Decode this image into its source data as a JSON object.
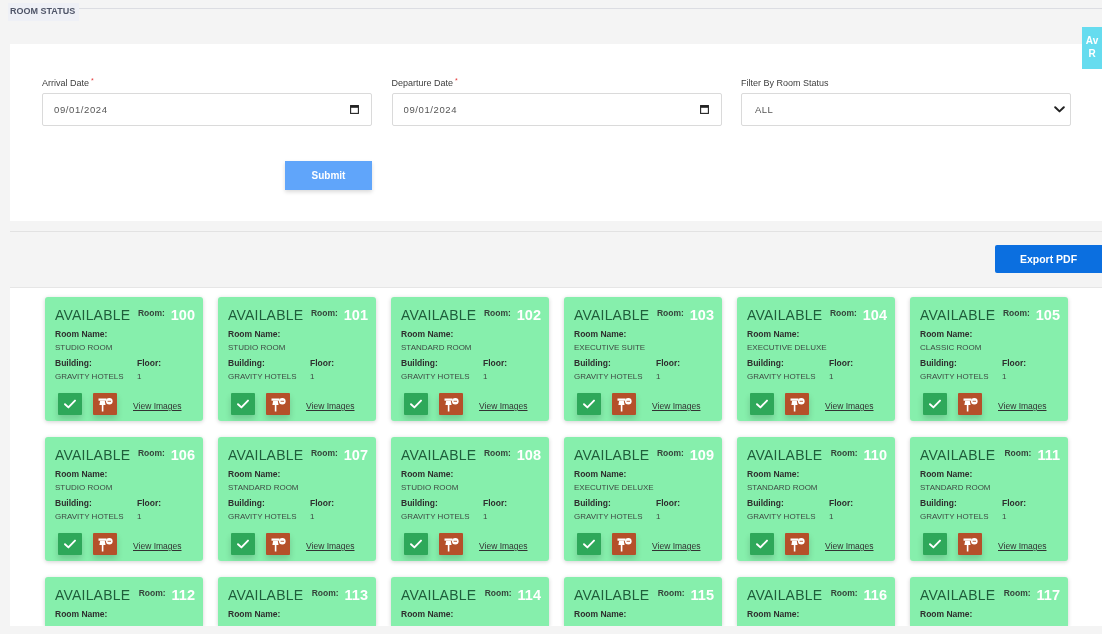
{
  "header": {
    "title": "ROOM STATUS"
  },
  "side_button": {
    "lines": [
      "Av",
      "R"
    ]
  },
  "filters": {
    "fields": [
      {
        "kind": "date",
        "label": "Arrival Date",
        "required_mark": "*",
        "value": "09/01/2024"
      },
      {
        "kind": "date",
        "label": "Departure Date",
        "required_mark": "*",
        "value": "09/01/2024"
      },
      {
        "kind": "select",
        "label": "Filter By Room Status",
        "value": "ALL"
      }
    ],
    "submit": "Submit"
  },
  "export_button": "Export PDF",
  "rooms": [
    {
      "status": "AVAILABLE",
      "room_label": "Room:",
      "room_number": "100",
      "name_label": "Room Name:",
      "room_name": "STUDIO ROOM",
      "building_label": "Building:",
      "building": "GRAVITY HOTELS",
      "floor_label": "Floor:",
      "floor": "1",
      "link": "View Images"
    },
    {
      "status": "AVAILABLE",
      "room_label": "Room:",
      "room_number": "101",
      "name_label": "Room Name:",
      "room_name": "STUDIO ROOM",
      "building_label": "Building:",
      "building": "GRAVITY HOTELS",
      "floor_label": "Floor:",
      "floor": "1",
      "link": "View Images"
    },
    {
      "status": "AVAILABLE",
      "room_label": "Room:",
      "room_number": "102",
      "name_label": "Room Name:",
      "room_name": "STANDARD ROOM",
      "building_label": "Building:",
      "building": "GRAVITY HOTELS",
      "floor_label": "Floor:",
      "floor": "1",
      "link": "View Images"
    },
    {
      "status": "AVAILABLE",
      "room_label": "Room:",
      "room_number": "103",
      "name_label": "Room Name:",
      "room_name": "EXECUTIVE SUITE",
      "building_label": "Building:",
      "building": "GRAVITY HOTELS",
      "floor_label": "Floor:",
      "floor": "1",
      "link": "View Images"
    },
    {
      "status": "AVAILABLE",
      "room_label": "Room:",
      "room_number": "104",
      "name_label": "Room Name:",
      "room_name": "EXECUTIVE DELUXE",
      "building_label": "Building:",
      "building": "GRAVITY HOTELS",
      "floor_label": "Floor:",
      "floor": "1",
      "link": "View Images"
    },
    {
      "status": "AVAILABLE",
      "room_label": "Room:",
      "room_number": "105",
      "name_label": "Room Name:",
      "room_name": "CLASSIC ROOM",
      "building_label": "Building:",
      "building": "GRAVITY HOTELS",
      "floor_label": "Floor:",
      "floor": "1",
      "link": "View Images"
    },
    {
      "status": "AVAILABLE",
      "room_label": "Room:",
      "room_number": "106",
      "name_label": "Room Name:",
      "room_name": "STUDIO ROOM",
      "building_label": "Building:",
      "building": "GRAVITY HOTELS",
      "floor_label": "Floor:",
      "floor": "1",
      "link": "View Images"
    },
    {
      "status": "AVAILABLE",
      "room_label": "Room:",
      "room_number": "107",
      "name_label": "Room Name:",
      "room_name": "STANDARD ROOM",
      "building_label": "Building:",
      "building": "GRAVITY HOTELS",
      "floor_label": "Floor:",
      "floor": "1",
      "link": "View Images"
    },
    {
      "status": "AVAILABLE",
      "room_label": "Room:",
      "room_number": "108",
      "name_label": "Room Name:",
      "room_name": "STUDIO ROOM",
      "building_label": "Building:",
      "building": "GRAVITY HOTELS",
      "floor_label": "Floor:",
      "floor": "1",
      "link": "View Images"
    },
    {
      "status": "AVAILABLE",
      "room_label": "Room:",
      "room_number": "109",
      "name_label": "Room Name:",
      "room_name": "EXECUTIVE DELUXE",
      "building_label": "Building:",
      "building": "GRAVITY HOTELS",
      "floor_label": "Floor:",
      "floor": "1",
      "link": "View Images"
    },
    {
      "status": "AVAILABLE",
      "room_label": "Room:",
      "room_number": "110",
      "name_label": "Room Name:",
      "room_name": "STANDARD ROOM",
      "building_label": "Building:",
      "building": "GRAVITY HOTELS",
      "floor_label": "Floor:",
      "floor": "1",
      "link": "View Images"
    },
    {
      "status": "AVAILABLE",
      "room_label": "Room:",
      "room_number": "111",
      "name_label": "Room Name:",
      "room_name": "STANDARD ROOM",
      "building_label": "Building:",
      "building": "GRAVITY HOTELS",
      "floor_label": "Floor:",
      "floor": "1",
      "link": "View Images"
    },
    {
      "status": "AVAILABLE",
      "room_label": "Room:",
      "room_number": "112",
      "name_label": "Room Name:"
    },
    {
      "status": "AVAILABLE",
      "room_label": "Room:",
      "room_number": "113",
      "name_label": "Room Name:"
    },
    {
      "status": "AVAILABLE",
      "room_label": "Room:",
      "room_number": "114",
      "name_label": "Room Name:"
    },
    {
      "status": "AVAILABLE",
      "room_label": "Room:",
      "room_number": "115",
      "name_label": "Room Name:"
    },
    {
      "status": "AVAILABLE",
      "room_label": "Room:",
      "room_number": "116",
      "name_label": "Room Name:"
    },
    {
      "status": "AVAILABLE",
      "room_label": "Room:",
      "room_number": "117",
      "name_label": "Room Name:"
    }
  ]
}
